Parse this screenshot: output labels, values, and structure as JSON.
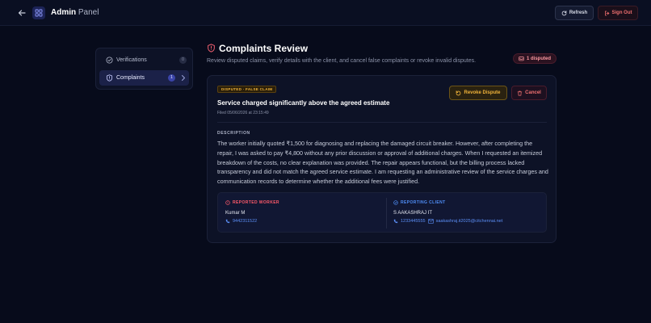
{
  "header": {
    "brand_bold": "Admin",
    "brand_light": "Panel",
    "refresh_label": "Refresh",
    "signout_label": "Sign Out"
  },
  "sidebar": {
    "items": [
      {
        "label": "Verifications",
        "count": "0",
        "active": false
      },
      {
        "label": "Complaints",
        "count": "1",
        "active": true
      }
    ]
  },
  "main": {
    "title": "Complaints Review",
    "subtitle": "Review disputed claims, verify details with the client, and cancel false complaints or revoke invalid disputes.",
    "badge": "1 disputed"
  },
  "complaint": {
    "tag": "DISPUTED · FALSE CLAIM",
    "title": "Service charged significantly above the agreed estimate",
    "filed": "Filed 05/06/2026 at 23:15:49",
    "revoke_label": "Revoke Dispute",
    "cancel_label": "Cancel",
    "description_heading": "DESCRIPTION",
    "description": "The worker initially quoted ₹1,500 for diagnosing and replacing the damaged circuit breaker. However, after completing the repair, I was asked to pay ₹4,800 without any prior discussion or approval of additional charges. When I requested an itemized breakdown of the costs, no clear explanation was provided. The repair appears functional, but the billing process lacked transparency and did not match the agreed service estimate. I am requesting an administrative review of the service charges and communication records to determine whether the additional fees were justified.",
    "worker": {
      "heading": "REPORTED WORKER",
      "name": "Kumar M",
      "phone": "9442311522"
    },
    "client": {
      "heading": "REPORTING CLIENT",
      "name": "S AAKASHRAJ IT",
      "phone": "1233445555",
      "email": "saakashraj.it2025@citchennai.net"
    }
  },
  "colors": {
    "background": "#070b1b",
    "accent": "#5b6cf2",
    "warning": "#f0b33a",
    "danger": "#f07070",
    "worker_accent": "#ff5a6a",
    "client_accent": "#4f8ef7"
  }
}
